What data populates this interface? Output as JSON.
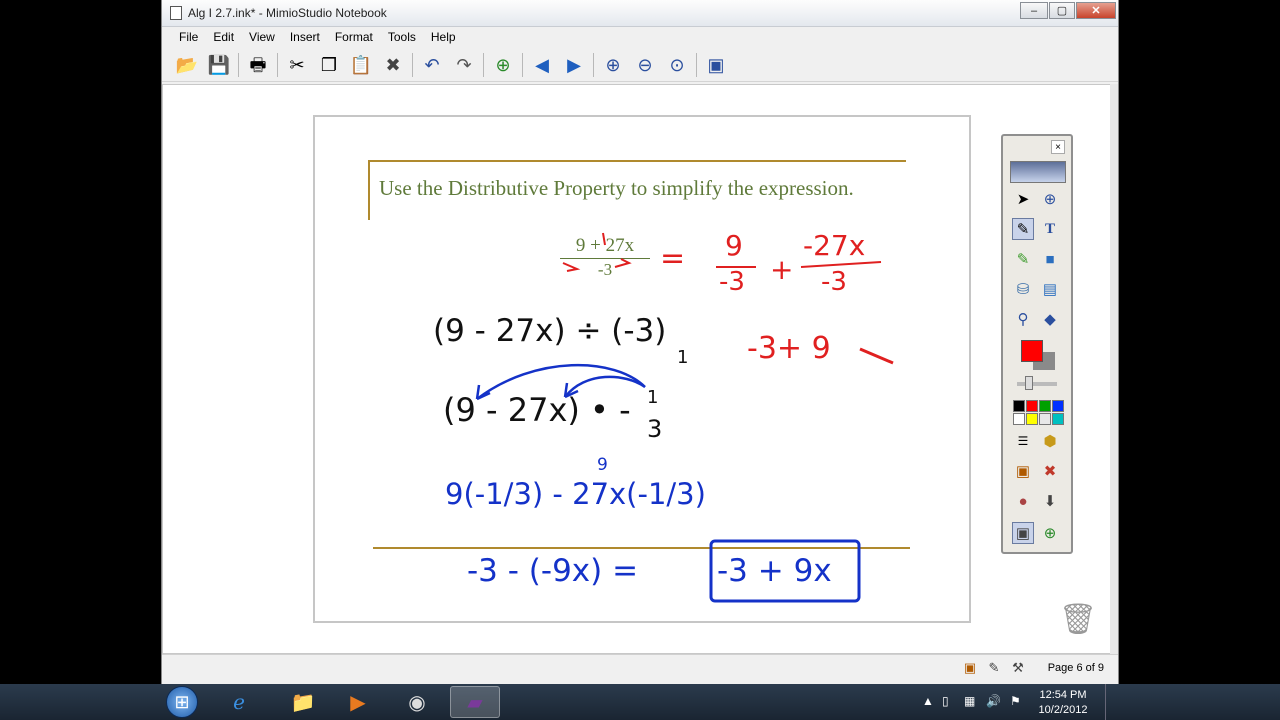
{
  "window": {
    "title": "Alg I 2.7.ink* - MimioStudio Notebook",
    "minimize": "‒",
    "maximize": "▢",
    "close": "✕"
  },
  "menu": {
    "items": [
      {
        "label": "File"
      },
      {
        "label": "Edit"
      },
      {
        "label": "View"
      },
      {
        "label": "Insert"
      },
      {
        "label": "Format"
      },
      {
        "label": "Tools"
      },
      {
        "label": "Help"
      }
    ]
  },
  "toolbar": {
    "icons": [
      "open-icon",
      "save-icon",
      "print-icon",
      "cut-icon",
      "copy-icon",
      "paste-icon",
      "delete-icon",
      "undo-icon",
      "redo-icon",
      "new-page-icon",
      "back-icon",
      "forward-icon",
      "zoom-in-icon",
      "zoom-out-icon",
      "zoom-fit-icon",
      "screen-icon"
    ]
  },
  "page": {
    "instruction": "Use the Distributive Property to simplify the expression.",
    "typed_fraction": {
      "numerator": "9 + 27x",
      "denominator": "-3"
    },
    "ink": {
      "red_eq": "=",
      "red_frac1_num": "9",
      "red_frac1_den": "-3",
      "red_plus": "+",
      "red_frac2_num": "-27x",
      "red_frac2_den": "-3",
      "red_result": "-3+ 9",
      "black_line1": "(9 - 27x) ÷ (-3)",
      "black_line1_sub": "1",
      "black_line2": "(9 - 27x) • -",
      "black_line2_frac_num": "1",
      "black_line2_frac_den": "3",
      "blue_line3": "9(-1/3) - 27x(-1/3)",
      "blue_line3_sup": "9",
      "black_line4_left": "-3  -  (-9x)  =",
      "blue_answer": "-3 + 9x"
    }
  },
  "status": {
    "page_indicator": "Page 6 of 9"
  },
  "palette": {
    "close": "×",
    "active_color": "#ff0000",
    "swatches": [
      "#000000",
      "#ff0000",
      "#00a000",
      "#0030ff",
      "#ffffff",
      "#ffff00",
      "#e8e8e8",
      "#00c0c0"
    ]
  },
  "taskbar": {
    "time": "12:54 PM",
    "date": "10/2/2012"
  }
}
